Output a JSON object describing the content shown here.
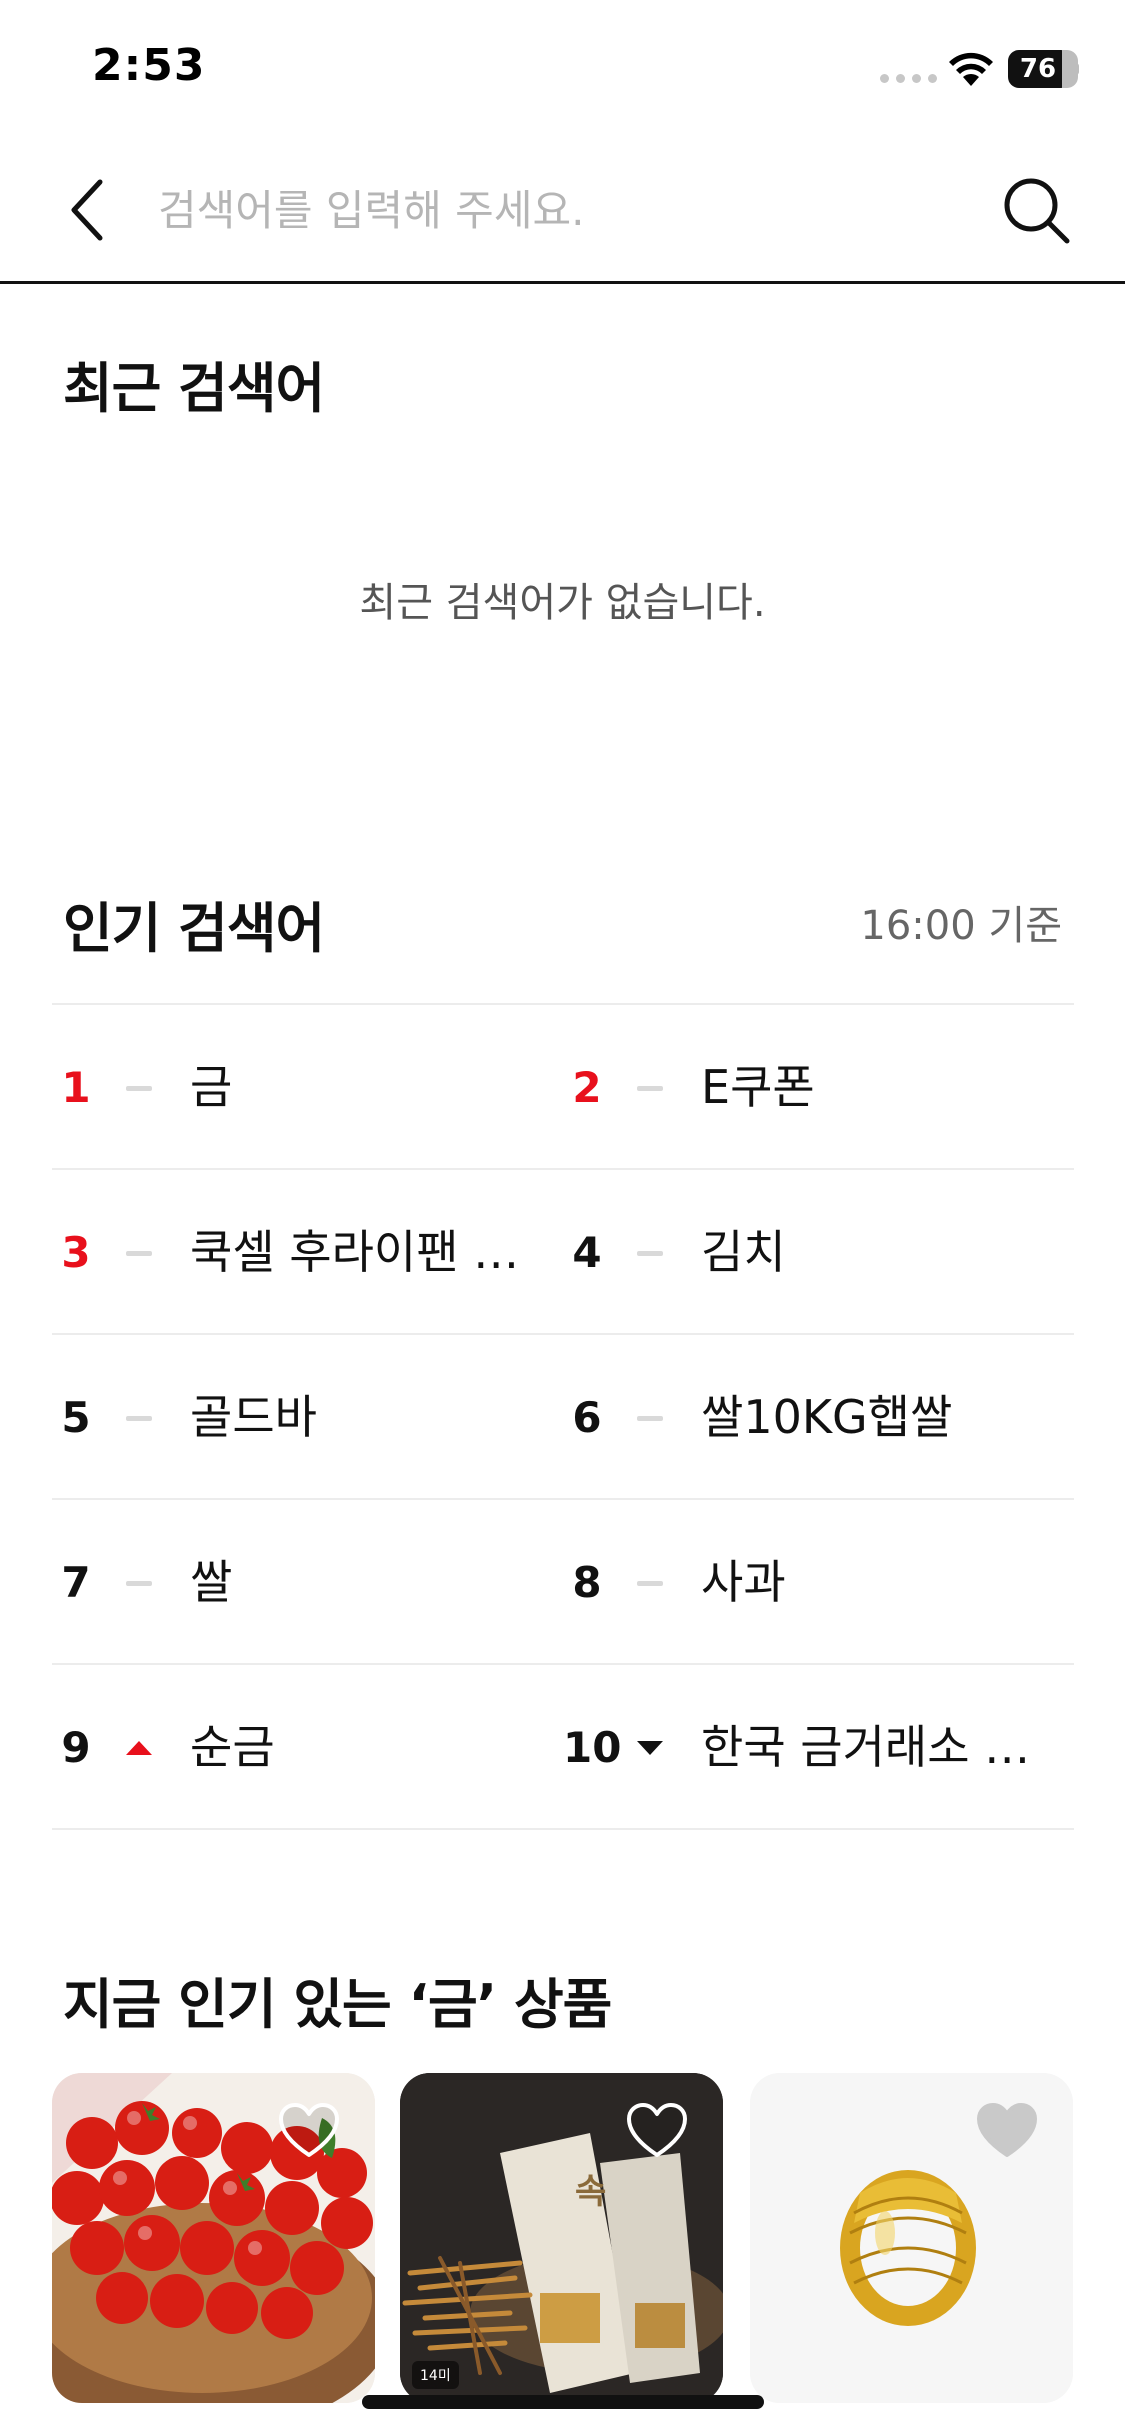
{
  "status_bar": {
    "time": "2:53",
    "battery": "76"
  },
  "search": {
    "placeholder": "검색어를 입력해 주세요.",
    "value": ""
  },
  "recent": {
    "title": "최근 검색어",
    "empty_message": "최근 검색어가 없습니다."
  },
  "popular": {
    "title": "인기 검색어",
    "basis": "16:00 기준",
    "ranks": [
      {
        "rank": "1",
        "label": "금",
        "trend": "same",
        "hot": true
      },
      {
        "rank": "2",
        "label": "E쿠폰",
        "trend": "same",
        "hot": true
      },
      {
        "rank": "3",
        "label": "쿡셀 후라이팬 …",
        "trend": "same",
        "hot": true
      },
      {
        "rank": "4",
        "label": "김치",
        "trend": "same",
        "hot": false
      },
      {
        "rank": "5",
        "label": "골드바",
        "trend": "same",
        "hot": false
      },
      {
        "rank": "6",
        "label": "쌀10KG햅쌀",
        "trend": "same",
        "hot": false
      },
      {
        "rank": "7",
        "label": "쌀",
        "trend": "same",
        "hot": false
      },
      {
        "rank": "8",
        "label": "사과",
        "trend": "same",
        "hot": false
      },
      {
        "rank": "9",
        "label": "순금",
        "trend": "up",
        "hot": false
      },
      {
        "rank": "10",
        "label": "한국 금거래소 …",
        "trend": "down",
        "hot": false
      }
    ]
  },
  "products": {
    "title": "지금 인기 있는 ‘금’ 상품",
    "items": [
      {
        "image": "cherry-tomatoes",
        "liked": false
      },
      {
        "image": "dried-pollack",
        "liked": false,
        "tag": "14미"
      },
      {
        "image": "gold-ring",
        "liked": false
      }
    ]
  },
  "colors": {
    "accent_red": "#e8101c",
    "text": "#111111",
    "muted": "#666666",
    "divider": "#ececec"
  }
}
